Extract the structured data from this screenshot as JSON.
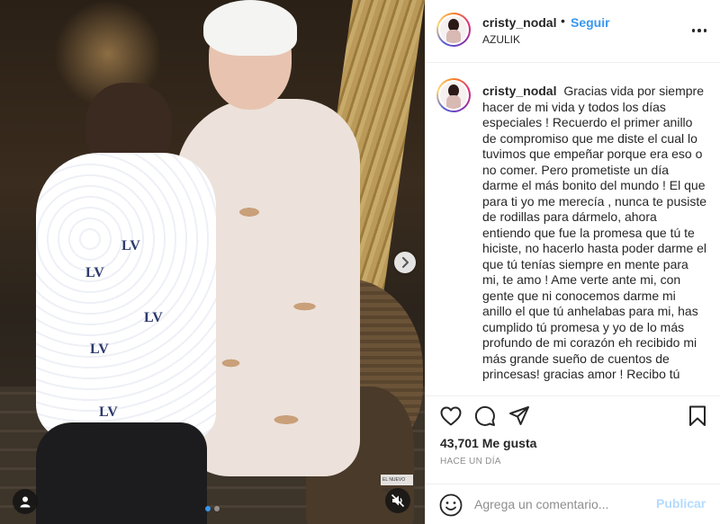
{
  "post": {
    "username": "cristy_nodal",
    "follow_label": "Seguir",
    "bullet": "•",
    "location": "AZULIK",
    "caption": "Gracias vida por siempre hacer de mi vida y todos los días especiales ! Recuerdo el primer anillo de compromiso que me diste el cual lo tuvimos que empeñar porque era eso o no comer. Pero prometiste un día darme el más bonito del mundo ! El que para ti yo me merecía , nunca te pusiste de rodillas para dármelo, ahora entiendo que fue la promesa que tú te hiciste, no hacerlo hasta poder darme el que tú tenías siempre en mente para mi, te amo ! Ame verte ante mi, con gente que ni conocemos darme mi anillo el que tú anhelabas para mi, has cumplido tú promesa y yo de lo más profundo de mi corazón eh recibido mi más grande sueño de cuentos de princesas! gracias amor ! Recibo tú",
    "likes": "43,701 Me gusta",
    "time": "HACE UN DÍA",
    "comment_placeholder": "Agrega un comentario...",
    "publish_label": "Publicar"
  },
  "media": {
    "watermark": "EL NUEVO HERALD",
    "carousel_total": 2,
    "carousel_active": 1
  },
  "icons": {
    "more": "more-options-icon",
    "like": "heart-icon",
    "comment": "comment-icon",
    "share": "paper-plane-icon",
    "save": "bookmark-icon",
    "emoji": "smiley-icon",
    "next": "chevron-right-icon",
    "user": "user-tag-icon",
    "mute": "speaker-muted-icon"
  },
  "colors": {
    "link_blue": "#3897f0",
    "publish_disabled": "#b3dbff",
    "muted_text": "#8e8e8e",
    "border": "#efefef"
  }
}
